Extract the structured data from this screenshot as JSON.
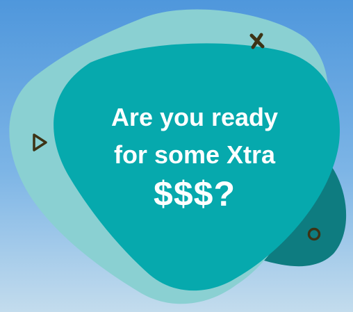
{
  "headline": {
    "line1": "Are you ready",
    "line2": "for some Xtra",
    "line3": "$$$?"
  },
  "decorations": {
    "icons": [
      "cross-icon",
      "triangle-play-icon",
      "circle-icon"
    ]
  },
  "colors": {
    "background_top": "#4f97dc",
    "background_bottom": "#c3dced",
    "blob_dark": "#0e7c80",
    "blob_light": "#8ad0d2",
    "blob_main": "#06a9ad",
    "icon_color": "#3d3315",
    "text": "#ffffff"
  }
}
